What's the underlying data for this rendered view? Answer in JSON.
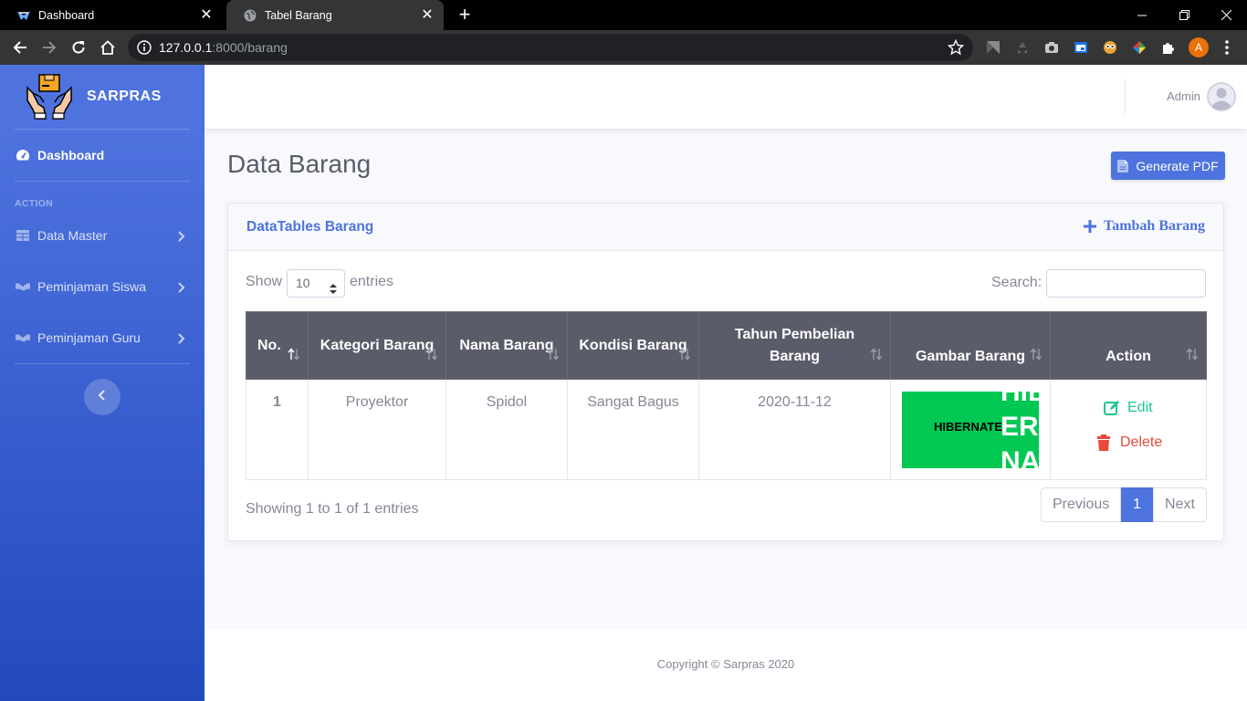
{
  "browser": {
    "tabs": [
      {
        "title": "Dashboard",
        "favicon": "app-icon",
        "active": false
      },
      {
        "title": "Tabel Barang",
        "favicon": "globe-icon",
        "active": true
      }
    ],
    "url_host": "127.0.0.1",
    "url_path": ":8000/barang",
    "profile_initial": "A"
  },
  "sidebar": {
    "brand": "SARPRAS",
    "heading": "ACTION",
    "items": [
      {
        "label": "Dashboard",
        "icon": "tachometer-icon"
      },
      {
        "label": "Data Master",
        "icon": "table-icon"
      },
      {
        "label": "Peminjaman Siswa",
        "icon": "handshake-icon"
      },
      {
        "label": "Peminjaman Guru",
        "icon": "handshake-icon"
      }
    ]
  },
  "topbar": {
    "user_name": "Admin"
  },
  "page": {
    "title": "Data Barang",
    "pdf_button": "Generate PDF"
  },
  "card": {
    "title": "DataTables Barang",
    "add_link": "Tambah Barang",
    "show_label": "Show",
    "entries_label": "entries",
    "page_length": "10",
    "search_label": "Search:",
    "search_value": "",
    "columns": [
      "No.",
      "Kategori Barang",
      "Nama Barang",
      "Kondisi Barang",
      "Tahun Pembelian Barang",
      "Gambar Barang",
      "Action"
    ],
    "rows": [
      {
        "no": "1",
        "kategori": "Proyektor",
        "nama": "Spidol",
        "kondisi": "Sangat Bagus",
        "tahun": "2020-11-12",
        "gambar_text": [
          "HIBERNATE",
          "HIB",
          "ER",
          "NA"
        ],
        "edit_label": "Edit",
        "delete_label": "Delete"
      }
    ],
    "info": "Showing 1 to 1 of 1 entries",
    "pagination": {
      "previous": "Previous",
      "current": "1",
      "next": "Next"
    }
  },
  "footer": {
    "copyright": "Copyright © Sarpras 2020"
  },
  "colors": {
    "primary": "#4e73df",
    "success": "#1cc88a",
    "danger": "#e74a3b",
    "header_dark": "#5a5c69"
  }
}
